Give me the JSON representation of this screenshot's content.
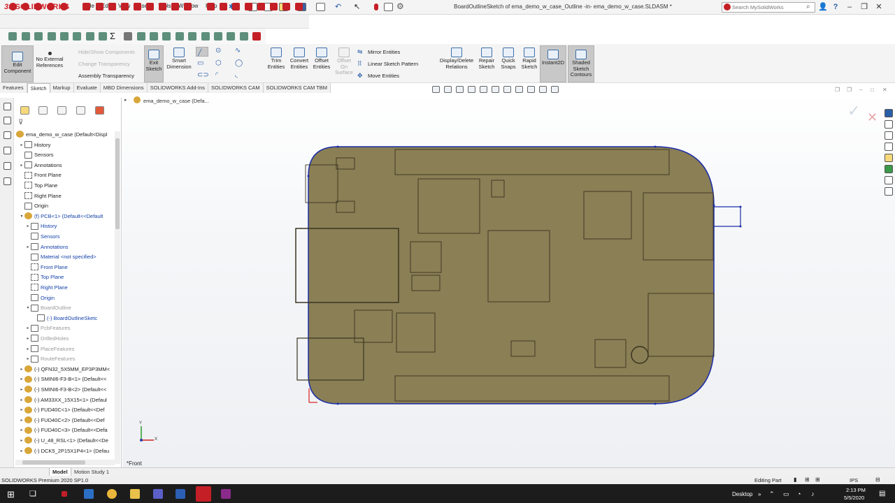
{
  "app": {
    "logo_ds": "3S",
    "logo_text": "SOLIDWORKS",
    "title": "BoardOutlineSketch of ema_demo_w_case_Outline -in- ema_demo_w_case.SLDASM *"
  },
  "menu": [
    "File",
    "Edit",
    "View",
    "Insert",
    "Tools",
    "Window",
    "Help"
  ],
  "search": {
    "placeholder": "Search MySolidWorks"
  },
  "commands": {
    "edit_component": "Edit Component",
    "no_external_refs": "No External References",
    "hide_show_components": "Hide/Show Components",
    "change_transparency": "Change Transparency",
    "assembly_transparency": "Assembly Transparency",
    "exit_sketch": "Exit Sketch",
    "smart_dimension": "Smart Dimension",
    "trim_entities": "Trim Entities",
    "convert_entities": "Convert Entities",
    "offset_entities": "Offset Entities",
    "offset_on_surface": "Offset On Surface",
    "mirror_entities": "Mirror Entities",
    "linear_sketch_pattern": "Linear Sketch Pattern",
    "move_entities": "Move Entities",
    "display_delete_relations": "Display/Delete Relations",
    "repair_sketch": "Repair Sketch",
    "quick_snaps": "Quick Snaps",
    "rapid_sketch": "Rapid Sketch",
    "instant2d": "Instant2D",
    "shaded_sketch_contours": "Shaded Sketch Contours"
  },
  "tabs": [
    "Features",
    "Sketch",
    "Markup",
    "Evaluate",
    "MBD Dimensions",
    "SOLIDWORKS Add-Ins",
    "SOLIDWORKS CAM",
    "SOLIDWORKS CAM TBM"
  ],
  "active_tab": "Sketch",
  "tree": {
    "root": "ema_demo_w_case  (Default<Displ",
    "items": [
      {
        "label": "History",
        "arrow": "▸",
        "indent": 1,
        "icon": "folder",
        "style": ""
      },
      {
        "label": "Sensors",
        "arrow": "",
        "indent": 1,
        "icon": "folder",
        "style": ""
      },
      {
        "label": "Annotations",
        "arrow": "▸",
        "indent": 1,
        "icon": "folder",
        "style": ""
      },
      {
        "label": "Front Plane",
        "arrow": "",
        "indent": 1,
        "icon": "plane",
        "style": ""
      },
      {
        "label": "Top Plane",
        "arrow": "",
        "indent": 1,
        "icon": "plane",
        "style": ""
      },
      {
        "label": "Right Plane",
        "arrow": "",
        "indent": 1,
        "icon": "plane",
        "style": ""
      },
      {
        "label": "Origin",
        "arrow": "",
        "indent": 1,
        "icon": "origin",
        "style": ""
      },
      {
        "label": "(f) PCB<1> (Default<<Default",
        "arrow": "▾",
        "indent": 1,
        "icon": "component",
        "style": "blue"
      },
      {
        "label": "History",
        "arrow": "▸",
        "indent": 2,
        "icon": "folder",
        "style": "blue"
      },
      {
        "label": "Sensors",
        "arrow": "",
        "indent": 2,
        "icon": "folder",
        "style": "blue"
      },
      {
        "label": "Annotations",
        "arrow": "▸",
        "indent": 2,
        "icon": "folder",
        "style": "blue"
      },
      {
        "label": "Material <not specified>",
        "arrow": "",
        "indent": 2,
        "icon": "material",
        "style": "blue"
      },
      {
        "label": "Front Plane",
        "arrow": "",
        "indent": 2,
        "icon": "plane",
        "style": "blue"
      },
      {
        "label": "Top Plane",
        "arrow": "",
        "indent": 2,
        "icon": "plane",
        "style": "blue"
      },
      {
        "label": "Right Plane",
        "arrow": "",
        "indent": 2,
        "icon": "plane",
        "style": "blue"
      },
      {
        "label": "Origin",
        "arrow": "",
        "indent": 2,
        "icon": "origin",
        "style": "blue"
      },
      {
        "label": "BoardOutline",
        "arrow": "▾",
        "indent": 2,
        "icon": "feature",
        "style": "gray"
      },
      {
        "label": "(-) BoardOutlineSketc",
        "arrow": "",
        "indent": 3,
        "icon": "sketch",
        "style": "blue"
      },
      {
        "label": "PcbFeatures",
        "arrow": "▸",
        "indent": 2,
        "icon": "folder",
        "style": "gray"
      },
      {
        "label": "DrilledHoles",
        "arrow": "▸",
        "indent": 2,
        "icon": "folder",
        "style": "gray"
      },
      {
        "label": "PlaceFeatures",
        "arrow": "▸",
        "indent": 2,
        "icon": "folder",
        "style": "gray"
      },
      {
        "label": "RouteFeatures",
        "arrow": "▸",
        "indent": 2,
        "icon": "folder",
        "style": "gray"
      },
      {
        "label": "(-) QFN32_5X5MM_EP3P3MM<",
        "arrow": "▸",
        "indent": 1,
        "icon": "component",
        "style": ""
      },
      {
        "label": "(-) SMINI6-F3-B<1> (Default<<",
        "arrow": "▸",
        "indent": 1,
        "icon": "component",
        "style": ""
      },
      {
        "label": "(-) SMINI6-F3-B<2> (Default<<",
        "arrow": "▸",
        "indent": 1,
        "icon": "component",
        "style": ""
      },
      {
        "label": "(-) AM33XX_15X15<1> (Defaul",
        "arrow": "▸",
        "indent": 1,
        "icon": "component",
        "style": ""
      },
      {
        "label": "(-) FUD40C<1> (Default<<Def",
        "arrow": "▸",
        "indent": 1,
        "icon": "component",
        "style": ""
      },
      {
        "label": "(-) FUD40C<2> (Default<<Def",
        "arrow": "▸",
        "indent": 1,
        "icon": "component",
        "style": ""
      },
      {
        "label": "(-) FUD40C<3> (Default<<Defa",
        "arrow": "▸",
        "indent": 1,
        "icon": "component",
        "style": ""
      },
      {
        "label": "(-) U_48_RSL<1> (Default<<De",
        "arrow": "▸",
        "indent": 1,
        "icon": "component",
        "style": ""
      },
      {
        "label": "(-) DCK5_2P15X1P4<1> (Defau",
        "arrow": "▸",
        "indent": 1,
        "icon": "component",
        "style": ""
      }
    ]
  },
  "viewport": {
    "breadcrumb": "ema_demo_w_case  (Defa...",
    "view_label": "*Front",
    "triad_x": "X",
    "triad_y": "Y"
  },
  "bottom_tabs": [
    "Model",
    "Motion Study 1"
  ],
  "status": {
    "left": "SOLIDWORKS Premium 2020 SP1.0",
    "mode": "Editing Part",
    "units": "IPS"
  },
  "taskbar": {
    "desktop": "Desktop",
    "time": "2:13 PM",
    "date": "5/5/2020"
  },
  "colors": {
    "board_fill": "#8a7f55",
    "board_outline": "#1b2da8",
    "accent_red": "#c41f26",
    "taskbar": "#1c1c1c"
  }
}
